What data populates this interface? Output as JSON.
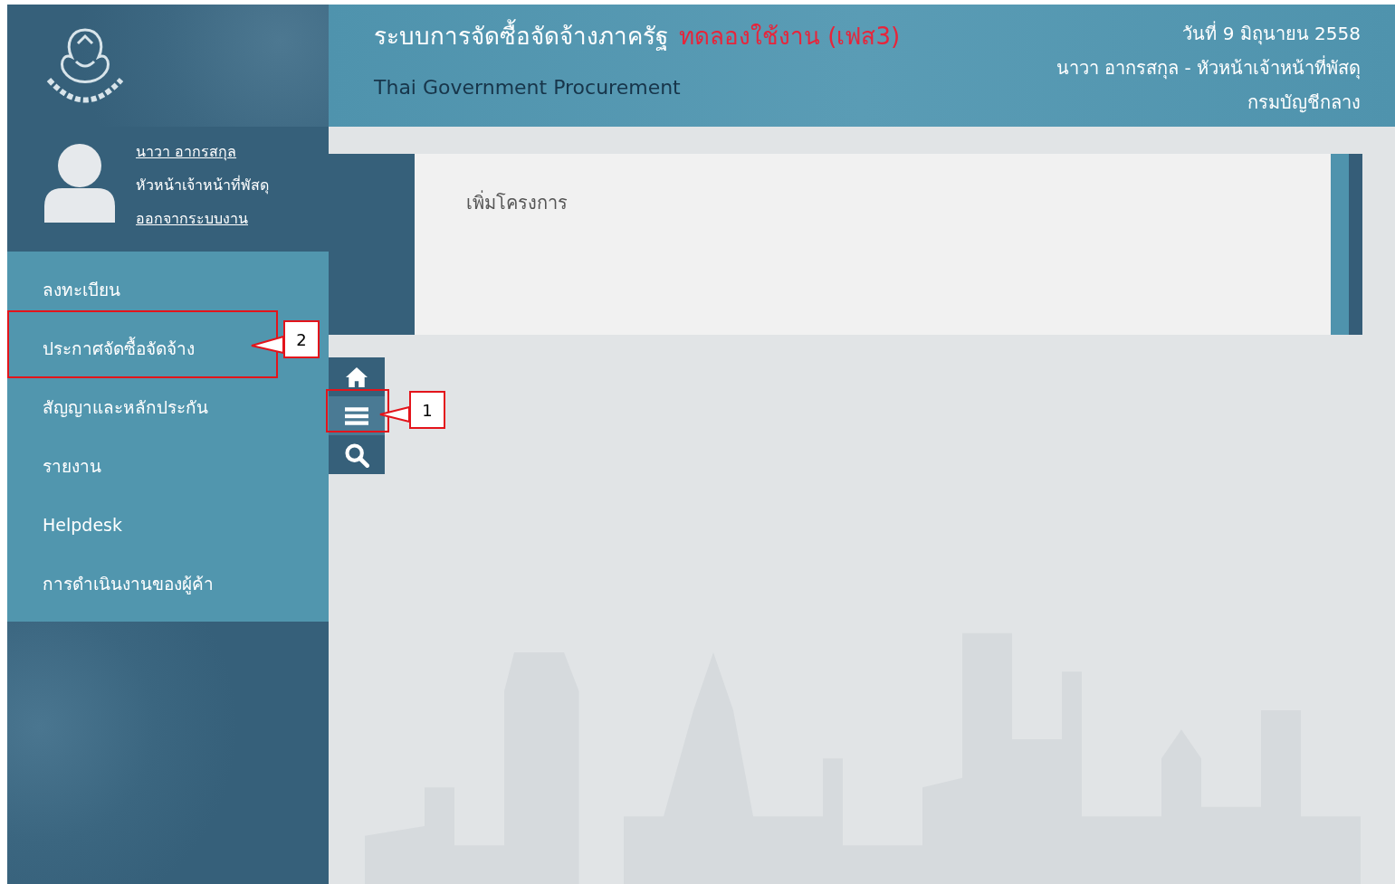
{
  "header": {
    "title": "ระบบการจัดซื้อจัดจ้างภาครัฐ",
    "title_badge": "ทดลองใช้งาน (เฟส3)",
    "subtitle": "Thai Government Procurement",
    "date": "วันที่ 9 มิถุนายน 2558",
    "user_line": "นาวา อากรสกุล - หัวหน้าเจ้าหน้าที่พัสดุ",
    "department": "กรมบัญชีกลาง"
  },
  "user": {
    "name": "นาวา อากรสกุล",
    "role": "หัวหน้าเจ้าหน้าที่พัสดุ",
    "logout": "ออกจากระบบงาน"
  },
  "menu": [
    {
      "label": "ลงทะเบียน"
    },
    {
      "label": "ประกาศจัดซื้อจัดจ้าง"
    },
    {
      "label": "สัญญาและหลักประกัน"
    },
    {
      "label": "รายงาน"
    },
    {
      "label": "Helpdesk"
    },
    {
      "label": "การดำเนินงานของผู้ค้า"
    }
  ],
  "panel": {
    "link": "เพิ่มโครงการ"
  },
  "callouts": [
    {
      "number": "2",
      "kind": "menu"
    },
    {
      "number": "1",
      "kind": "toolbar"
    }
  ]
}
